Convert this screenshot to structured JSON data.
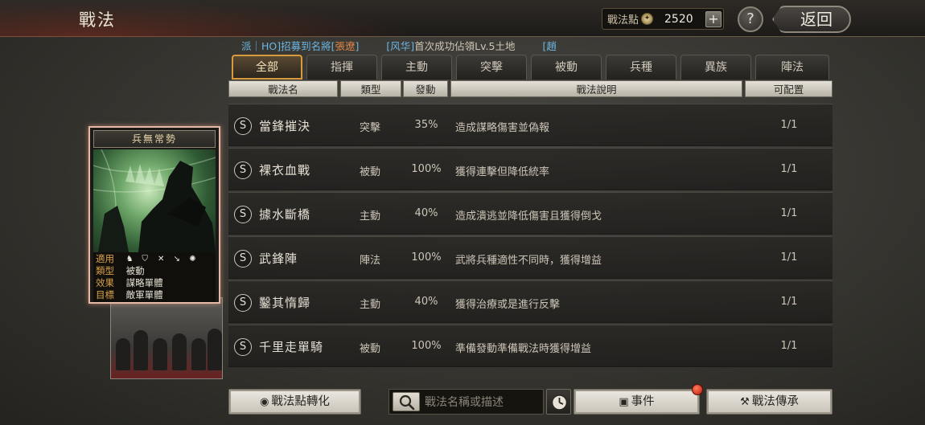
{
  "header": {
    "title": "戰法",
    "points_label": "戰法點",
    "points_value": "2520",
    "plus_label": "+",
    "help_label": "?",
    "back_label": "返回"
  },
  "ticker": {
    "t1_prefix": "派｜HO]招募到名將[",
    "t1_highlight": "張遼",
    "t1_suffix": "]",
    "t2_prefix": "[风华]",
    "t2_text": "首次成功佔領Lv.5土地",
    "t3_text": "[趙"
  },
  "tabs": [
    {
      "label": "全部",
      "active": true
    },
    {
      "label": "指揮",
      "active": false
    },
    {
      "label": "主動",
      "active": false
    },
    {
      "label": "突擊",
      "active": false
    },
    {
      "label": "被動",
      "active": false
    },
    {
      "label": "兵種",
      "active": false
    },
    {
      "label": "異族",
      "active": false
    },
    {
      "label": "陣法",
      "active": false
    }
  ],
  "columns": {
    "name": "戰法名",
    "type": "類型",
    "rate": "發動",
    "desc": "戰法說明",
    "slot": "可配置"
  },
  "rows": [
    {
      "badge": "S",
      "name": "當鋒摧決",
      "type": "突擊",
      "rate": "35%",
      "desc": "造成謀略傷害並偽報",
      "slot": "1/1"
    },
    {
      "badge": "S",
      "name": "裸衣血戰",
      "type": "被動",
      "rate": "100%",
      "desc": "獲得連擊但降低統率",
      "slot": "1/1"
    },
    {
      "badge": "S",
      "name": "據水斷橋",
      "type": "主動",
      "rate": "40%",
      "desc": "造成潰逃並降低傷害且獲得倒戈",
      "slot": "1/1"
    },
    {
      "badge": "S",
      "name": "武鋒陣",
      "type": "陣法",
      "rate": "100%",
      "desc": "武將兵種適性不同時，獲得增益",
      "slot": "1/1"
    },
    {
      "badge": "S",
      "name": "鑿其惰歸",
      "type": "主動",
      "rate": "40%",
      "desc": "獲得治療或是進行反擊",
      "slot": "1/1"
    },
    {
      "badge": "S",
      "name": "千里走單騎",
      "type": "被動",
      "rate": "100%",
      "desc": "準備發動準備戰法時獲得增益",
      "slot": "1/1"
    }
  ],
  "card": {
    "title": "兵無常勢",
    "apply_label": "適用",
    "apply_icons": [
      "cavalry-icon",
      "shield-icon",
      "bow-icon",
      "spear-icon",
      "siege-icon"
    ],
    "type_label": "類型",
    "type_value": "被動",
    "effect_label": "效果",
    "effect_value": "謀略單體",
    "target_label": "目標",
    "target_value": "敵軍單體"
  },
  "bottom": {
    "convert_label": "戰法點轉化",
    "search_placeholder": "戰法名稱或描述",
    "event_label": "事件",
    "inherit_label": "戰法傳承"
  },
  "colors": {
    "accent": "#d79a3c",
    "ticker_blue": "#6db7e4",
    "ticker_orange": "#e0874a",
    "card_border": "#e6b8a8"
  }
}
